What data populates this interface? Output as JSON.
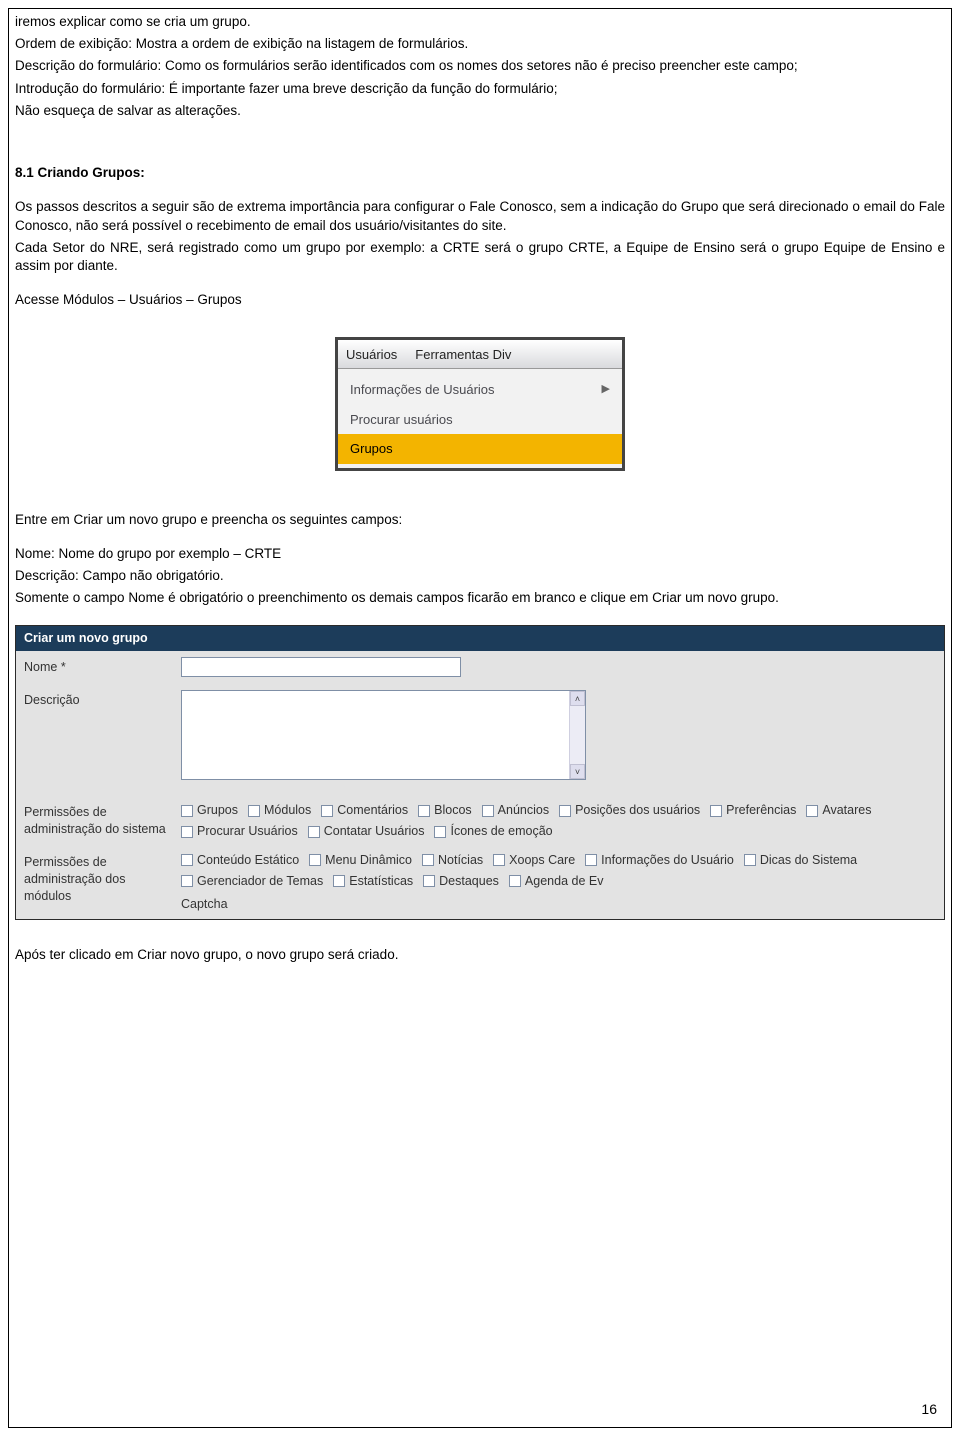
{
  "intro": {
    "p1": "iremos explicar como se cria um grupo.",
    "p2": "Ordem de exibição: Mostra a ordem de exibição na listagem de formulários.",
    "p3": "Descrição do formulário: Como os formulários serão identificados com os nomes dos setores não é preciso preencher este campo;",
    "p4": "Introdução do formulário: É importante fazer uma breve descrição da função do formulário;",
    "p5": "Não esqueça de salvar as alterações."
  },
  "section": {
    "heading": "8.1 Criando Grupos:",
    "p1": "Os passos descritos a seguir são de extrema importância para configurar o Fale Conosco, sem a indicação do Grupo que será direcionado o email do Fale Conosco, não será possível o recebimento de email dos usuário/visitantes do site.",
    "p2": "Cada Setor do NRE, será registrado como um grupo por exemplo: a CRTE será o grupo CRTE, a Equipe de Ensino será o grupo Equipe de Ensino e assim por diante.",
    "p3": "Acesse Módulos – Usuários – Grupos"
  },
  "menu": {
    "tab1": "Usuários",
    "tab2": "Ferramentas Div",
    "item1": "Informações de Usuários",
    "item2": "Procurar usuários",
    "item3": "Grupos"
  },
  "mid": {
    "p1": "Entre em Criar um novo grupo e preencha os seguintes campos:",
    "p2": "Nome: Nome do grupo por exemplo – CRTE",
    "p3": "Descrição: Campo não obrigatório.",
    "p4": "Somente o campo Nome é obrigatório o preenchimento os demais campos ficarão em branco e clique em Criar um novo grupo."
  },
  "form": {
    "title": "Criar um novo grupo",
    "labels": {
      "nome": "Nome *",
      "descricao": "Descrição",
      "perm_sys": "Permissões de administração do sistema",
      "perm_mod": "Permissões de administração dos módulos"
    },
    "perm_sys": [
      "Grupos",
      "Módulos",
      "Comentários",
      "Blocos",
      "Anúncios",
      "Posições dos usuários",
      "Preferências",
      "Avatares",
      "Procurar Usuários",
      "Contatar Usuários",
      "Ícones de emoção"
    ],
    "perm_mod": [
      "Conteúdo Estático",
      "Menu Dinâmico",
      "Notícias",
      "Xoops Care",
      "Informações do Usuário",
      "Dicas do Sistema",
      "Gerenciador de Temas",
      "Estatísticas",
      "Destaques",
      "Agenda de Ev"
    ],
    "captcha": "Captcha"
  },
  "after": {
    "p1": "Após ter clicado em Criar novo grupo, o novo grupo será criado."
  },
  "page_number": "16"
}
